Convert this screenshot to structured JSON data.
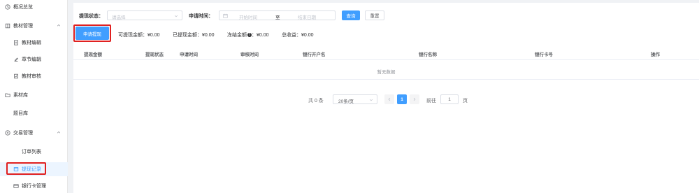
{
  "sidebar": {
    "items": [
      {
        "label": "概况总览",
        "icon": "clock-icon"
      },
      {
        "label": "教材管理",
        "icon": "book-icon",
        "expanded": true
      },
      {
        "label": "教材编辑",
        "icon": "document-icon"
      },
      {
        "label": "章节编辑",
        "icon": "edit-icon"
      },
      {
        "label": "教材审核",
        "icon": "audit-icon"
      },
      {
        "label": "素材库",
        "icon": "folder-icon"
      },
      {
        "label": "题目库",
        "icon": ""
      },
      {
        "label": "交易管理",
        "icon": "trade-icon",
        "expanded": true
      },
      {
        "label": "订单列表",
        "icon": ""
      },
      {
        "label": "提现记录",
        "icon": "withdraw-icon",
        "active": true
      },
      {
        "label": "银行卡管理",
        "icon": "card-icon"
      }
    ]
  },
  "filters": {
    "status_label": "提现状态：",
    "status_placeholder": "请选择",
    "time_label": "申请时间：",
    "start_placeholder": "开始时间",
    "range_separator": "至",
    "end_placeholder": "结束日期",
    "search_button": "查询",
    "reset_button": "重置"
  },
  "apply_button": "申请提现",
  "stats": {
    "available": "可提现金额：¥0.00",
    "withdrawn": "已提现金额：¥0.00",
    "frozen_label": "冻结金额",
    "frozen_value": "：¥0.00",
    "total": "总收益：¥0.00"
  },
  "table": {
    "columns": [
      "提现金额",
      "提现状态",
      "申请时间",
      "审核时间",
      "银行开户名",
      "银行名称",
      "银行卡号",
      "操作"
    ],
    "empty_text": "暂无数据"
  },
  "pagination": {
    "total": "共 0 条",
    "page_size": "20条/页",
    "current_page": "1",
    "goto_label": "前往",
    "goto_value": "1",
    "page_suffix": "页"
  },
  "colors": {
    "primary": "#409eff",
    "highlight": "#e02020"
  }
}
